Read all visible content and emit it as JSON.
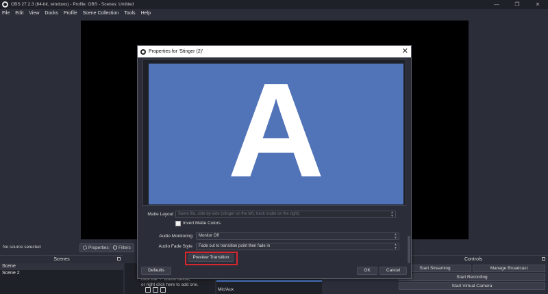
{
  "window": {
    "title": "OBS 27.2.3 (64-bit, windows) - Profile: OBS - Scenes: Untitled",
    "controls": [
      "—",
      "❐",
      "✕"
    ]
  },
  "menu": [
    "File",
    "Edit",
    "View",
    "Docks",
    "Profile",
    "Scene Collection",
    "Tools",
    "Help"
  ],
  "source_toolbar": {
    "status": "No source selected",
    "properties_label": "Properties",
    "filters_label": "Filters"
  },
  "scenes": {
    "header": "Scenes",
    "items": [
      "Scene",
      "Scene 2"
    ]
  },
  "sources": {
    "hint_line1": "click the '+' button below,",
    "hint_line2": "or right click here to add one."
  },
  "mixer": {
    "channel": "Mic/Aux"
  },
  "controls": {
    "header": "Controls",
    "start_streaming": "Start Streaming",
    "manage_broadcast": "Manage Broadcast",
    "start_recording": "Start Recording",
    "start_virtual_camera": "Start Virtual Camera"
  },
  "dialog": {
    "title": "Properties for 'Stinger (2)'",
    "close": "✕",
    "preview_letter": "A",
    "matte_layout": {
      "label": "Matte Layout",
      "value": "Same file, side-by-side (stinger on the left, track matte on the right)"
    },
    "invert_matte_label": "Invert Matte Colors",
    "audio_monitoring": {
      "label": "Audio Monitoring",
      "value": "Monitor Off"
    },
    "audio_fade_style": {
      "label": "Audio Fade Style",
      "value": "Fade out to transition point then fade in"
    },
    "preview_button": "Preview Transition",
    "defaults_button": "Defaults",
    "ok_button": "OK",
    "cancel_button": "Cancel"
  },
  "colors": {
    "preview_bg": "#5173b8",
    "highlight": "#d8262f",
    "mixer_bar": "#4a78c8"
  }
}
